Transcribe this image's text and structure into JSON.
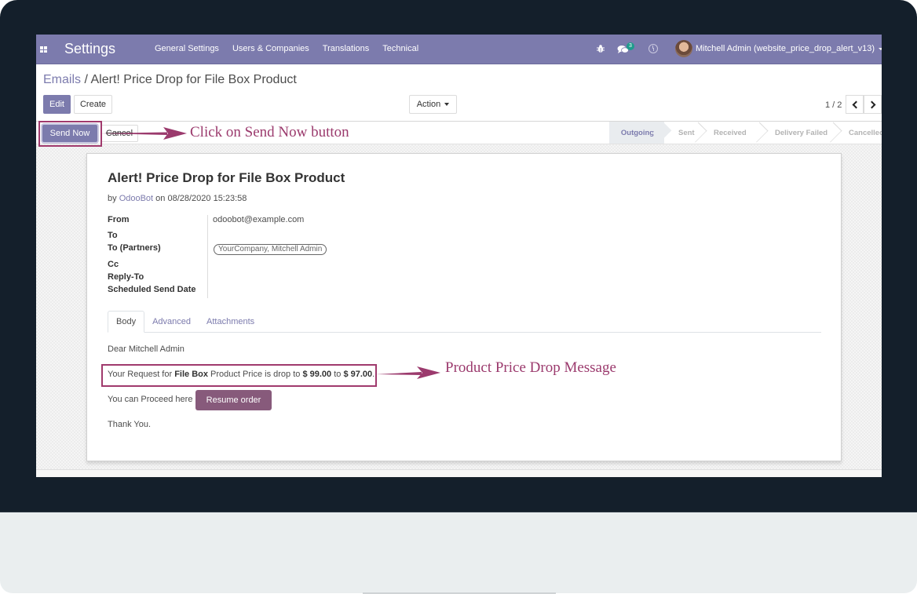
{
  "navbar": {
    "app_title": "Settings",
    "menu": [
      "General Settings",
      "Users & Companies",
      "Translations",
      "Technical"
    ],
    "icons": {
      "apps": "apps-grid-icon",
      "debug": "bug-icon",
      "messages": "chat-icon",
      "activities": "clock-icon"
    },
    "message_count": "3",
    "user_name": "Mitchell Admin (website_price_drop_alert_v13)"
  },
  "breadcrumb": {
    "parent": "Emails",
    "separator": "/",
    "current": "Alert! Price Drop for File Box Product"
  },
  "toolbar": {
    "edit_label": "Edit",
    "create_label": "Create",
    "action_label": "Action",
    "pager": "1 / 2"
  },
  "statusbar": {
    "send_now_label": "Send Now",
    "cancel_label": "Cancel",
    "stages": [
      {
        "label": "Outgoing",
        "active": true
      },
      {
        "label": "Sent",
        "active": false
      },
      {
        "label": "Received",
        "active": false
      },
      {
        "label": "Delivery Failed",
        "active": false
      },
      {
        "label": "Cancelled",
        "active": false
      }
    ]
  },
  "email": {
    "subject": "Alert! Price Drop for File Box Product",
    "meta_by": "by",
    "author": "OdooBot",
    "meta_on": "on 08/28/2020 15:23:58",
    "fields": [
      {
        "label": "From",
        "value": "odoobot@example.com"
      },
      {
        "label": "To",
        "value": ""
      },
      {
        "label": "To (Partners)",
        "value": "YourCompany, Mitchell Admin"
      },
      {
        "label": "Cc",
        "value": ""
      },
      {
        "label": "Reply-To",
        "value": ""
      },
      {
        "label": "Scheduled Send Date",
        "value": ""
      }
    ],
    "tabs": [
      "Body",
      "Advanced",
      "Attachments"
    ],
    "active_tab": "Body",
    "body": {
      "greeting": "Dear Mitchell Admin",
      "msg_part1": "Your Request for ",
      "product": "File Box",
      "msg_part2": " Product Price is drop to ",
      "old_price": "$ 99.00",
      "msg_part3": " to ",
      "new_price": "$ 97.00",
      "msg_end": ".",
      "proceed_text": "You can Proceed here",
      "resume_label": "Resume order",
      "closing": "Thank You."
    }
  },
  "annotations": {
    "send_now_note": "Click on Send Now button",
    "price_drop_note": "Product Price Drop Message",
    "color": "#9b3a6d"
  },
  "colors": {
    "brand": "#7c7bad",
    "resume_button": "#875a7b",
    "badge": "#1e9c8c"
  }
}
